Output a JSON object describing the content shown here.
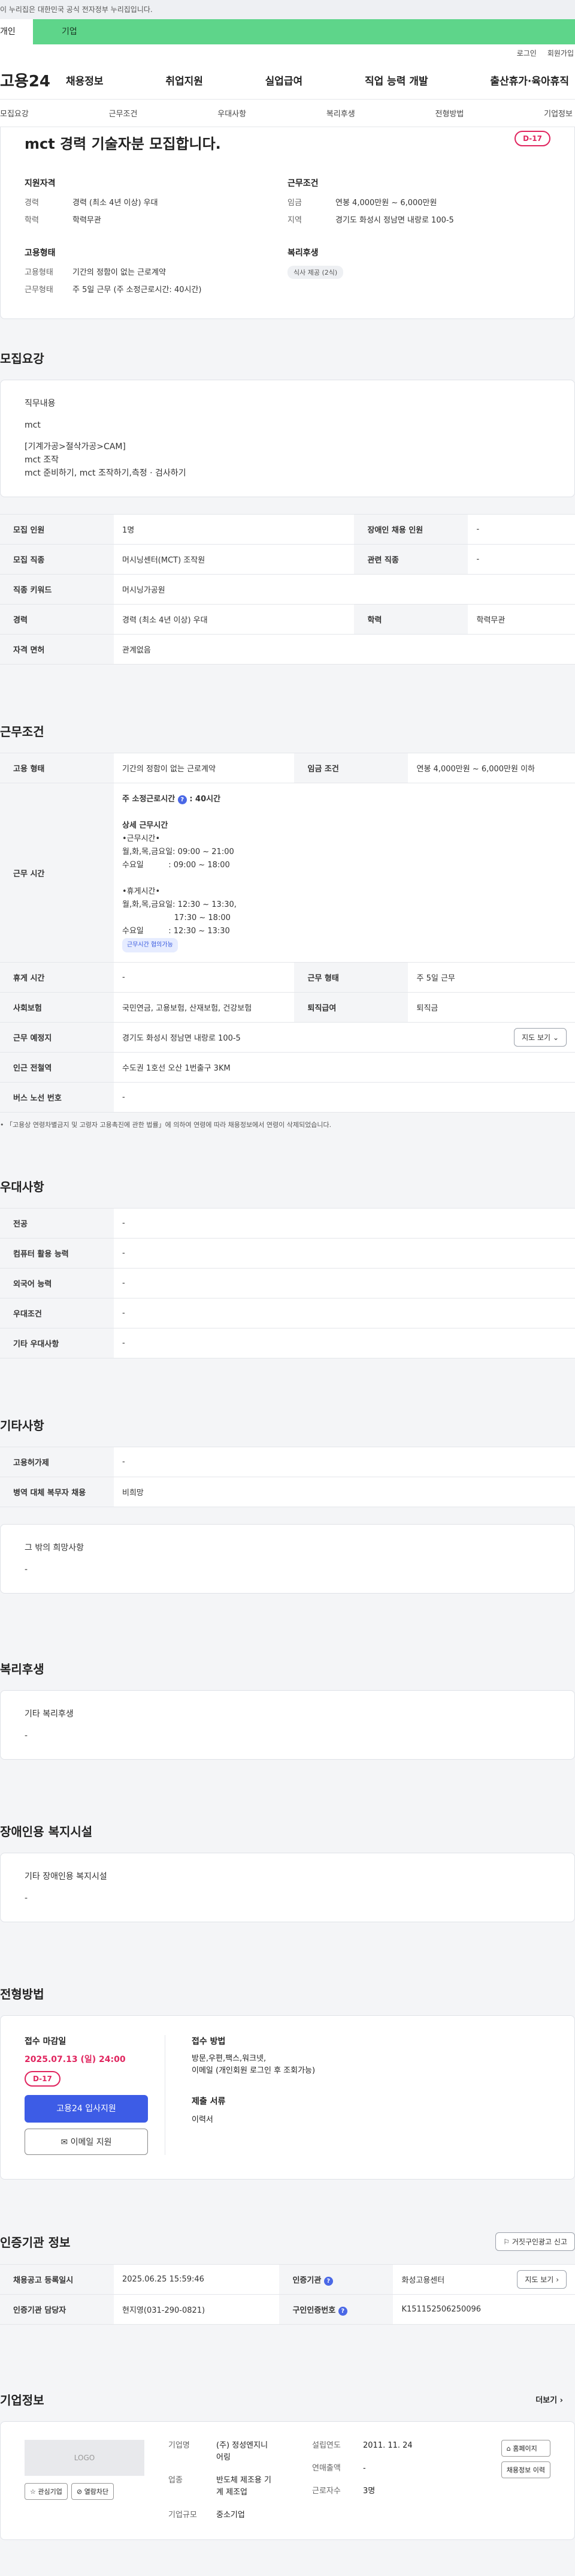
{
  "top_notice": "이 누리집은 대한민국 공식 전자정부 누리집입니다.",
  "segments": {
    "s1": "개인",
    "s2": "기업"
  },
  "util": {
    "login": "로그인",
    "signup": "회원가입"
  },
  "gnb": {
    "logo": "고용24",
    "menu": [
      "채용정보",
      "취업지원",
      "실업급여",
      "직업 능력 개발",
      "출산휴가·육아휴직"
    ]
  },
  "tabs": [
    "모집요강",
    "근무조건",
    "우대사항",
    "복리후생",
    "전형방법",
    "기업정보"
  ],
  "hero": {
    "title": "mct 경력 기술자분 모집합니다.",
    "dday": "D-17",
    "qual": {
      "h": "지원자격",
      "k1": "경력",
      "v1": "경력 (최소 4년 이상) 우대",
      "k2": "학력",
      "v2": "학력무관"
    },
    "cond": {
      "h": "근무조건",
      "k1": "임금",
      "v1": "연봉 4,000만원 ~ 6,000만원",
      "k2": "지역",
      "v2": "경기도 화성시 정남면 내랑로 100-5"
    },
    "emp": {
      "h": "고용형태",
      "k1": "고용형태",
      "v1": "기간의 정함이 없는 근로계약",
      "k2": "근무형태",
      "v2": "주 5일 근무 (주 소정근로시간: 40시간)"
    },
    "welfare": {
      "h": "복리후생",
      "chip": "식사 제공 (2식)"
    }
  },
  "recruit": {
    "title": "모집요강",
    "duty_label": "직무내용",
    "duty_lines": [
      "mct",
      "",
      "[기계가공>절삭가공>CAM]",
      "mct 조작",
      "mct 준비하기, mct 조작하기,측정 · 검사하기"
    ],
    "rows": [
      {
        "k1": "모집 인원",
        "v1": "1명",
        "k2": "장애인 채용 인원",
        "v2": "-"
      },
      {
        "k1": "모집 직종",
        "v1": "머시닝센터(MCT) 조작원",
        "k2": "관련 직종",
        "v2": "-"
      },
      {
        "k1": "직종 키워드",
        "v1": "머시닝가공원"
      },
      {
        "k1": "경력",
        "v1": "경력 (최소 4년 이상) 우대",
        "k2": "학력",
        "v2": "학력무관"
      },
      {
        "k1": "자격 면허",
        "v1": "관계없음"
      }
    ]
  },
  "work": {
    "title": "근무조건",
    "emp_k": "고용 형태",
    "emp_v": "기간의 정함이 없는 근로계약",
    "wage_k": "임금 조건",
    "wage_v": "연봉 4,000만원 ~ 6,000만원 이하",
    "time_k": "근무 시간",
    "time_head": "주 소정근로시간",
    "time_head_val": ": 40시간",
    "time_lines": [
      "",
      "상세 근무시간",
      "•근무시간•",
      "월,화,목,금요일: 09:00 ~ 21:00",
      "수요일          : 09:00 ~ 18:00",
      "",
      "•휴게시간•",
      "월,화,목,금요일: 12:30 ~ 13:30,",
      "                     17:30 ~ 18:00",
      "수요일          : 12:30 ~ 13:30"
    ],
    "time_badge": "근무시간 협의가능",
    "rest_k": "휴게 시간",
    "rest_v": "-",
    "form_k": "근무 형태",
    "form_v": "주 5일 근무",
    "ins_k": "사회보험",
    "ins_v": "국민연금, 고용보험, 산재보험, 건강보험",
    "ret_k": "퇴직급여",
    "ret_v": "퇴직금",
    "place_k": "근무 예정지",
    "place_v": "경기도 화성시 정남면 내랑로 100-5",
    "map_btn": "지도 보기",
    "station_k": "인근 전철역",
    "station_v": "수도권 1호선 오산 1번출구 3KM",
    "bus_k": "버스 노선 번호",
    "bus_v": "-",
    "note": "「고용상 연령차별금지 및 고령자 고용촉진에 관한 법률」에 의하여 연령에 따라 채용정보에서 연령이 삭제되었습니다."
  },
  "pref": {
    "title": "우대사항",
    "rows": [
      {
        "k": "전공",
        "v": "-"
      },
      {
        "k": "컴퓨터 활용 능력",
        "v": "-"
      },
      {
        "k": "외국어 능력",
        "v": "-"
      },
      {
        "k": "우대조건",
        "v": "-"
      },
      {
        "k": "기타 우대사항",
        "v": "-"
      }
    ]
  },
  "etc": {
    "title": "기타사항",
    "rows": [
      {
        "k": "고용허가제",
        "v": "-"
      },
      {
        "k": "병역 대체 복무자 채용",
        "v": "비희망"
      }
    ],
    "box_label": "그 밖의 희망사항",
    "box_val": "-"
  },
  "welfare": {
    "title": "복리후생",
    "box_label": "기타 복리후생",
    "box_val": "-"
  },
  "disabled": {
    "title": "장애인용 복지시설",
    "box_label": "기타 장애인용 복지시설",
    "box_val": "-"
  },
  "apply": {
    "title": "전형방법",
    "deadline_label": "접수 마감일",
    "deadline": "2025.07.13 (일) 24:00",
    "dday": "D-17",
    "btn_apply": "고용24 입사지원",
    "btn_email": "이메일 지원",
    "method_label": "접수 방법",
    "method_v1": "방문,우편,팩스,워크넷,",
    "method_v2": "이메일 (개인회원 로그인 후 조회가능)",
    "docs_label": "제출 서류",
    "docs_v": "이력서"
  },
  "cert": {
    "title": "인증기관 정보",
    "report_btn": "거짓구인광고 신고",
    "r1k1": "채용공고 등록일시",
    "r1v1": "2025.06.25 15:59:46",
    "r1k2": "인증기관",
    "r1v2": "화성고용센터",
    "map_btn": "지도 보기",
    "r2k1": "인증기관 담당자",
    "r2v1": "현지영(031-290-0821)",
    "r2k2": "구인인증번호",
    "r2v2": "K151152506250096"
  },
  "company": {
    "title": "기업정보",
    "more": "더보기",
    "logo": "LOGO",
    "btn_fav": "관심기업",
    "btn_block": "열람차단",
    "name_k": "기업명",
    "name_v1": "(주) 정성엔지니",
    "name_v2": "어링",
    "biz_k": "업종",
    "biz_v1": "반도체 제조용 기",
    "biz_v2": "계 제조업",
    "size_k": "기업규모",
    "size_v": "중소기업",
    "est_k": "설립연도",
    "est_v": "2011. 11. 24",
    "sales_k": "연매출액",
    "sales_v": "-",
    "emp_k": "근로자수",
    "emp_v": "3명",
    "home_btn": "홈페이지",
    "jobs_btn": "채용정보 이력"
  }
}
